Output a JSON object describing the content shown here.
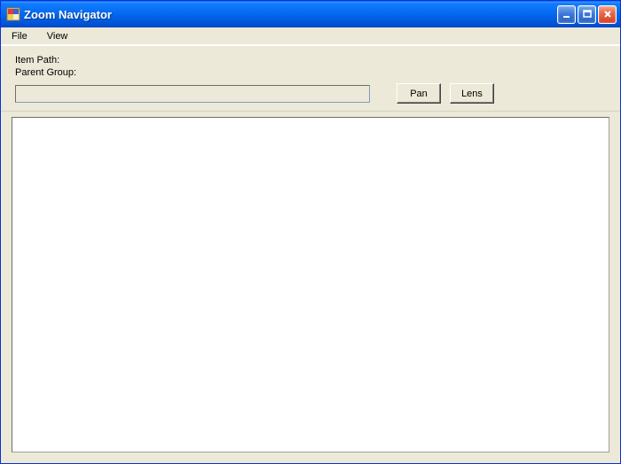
{
  "window": {
    "title": "Zoom Navigator"
  },
  "menubar": {
    "file": "File",
    "view": "View"
  },
  "labels": {
    "item_path": "Item Path:",
    "parent_group": "Parent Group:"
  },
  "input": {
    "value": ""
  },
  "buttons": {
    "pan": "Pan",
    "lens": "Lens"
  }
}
